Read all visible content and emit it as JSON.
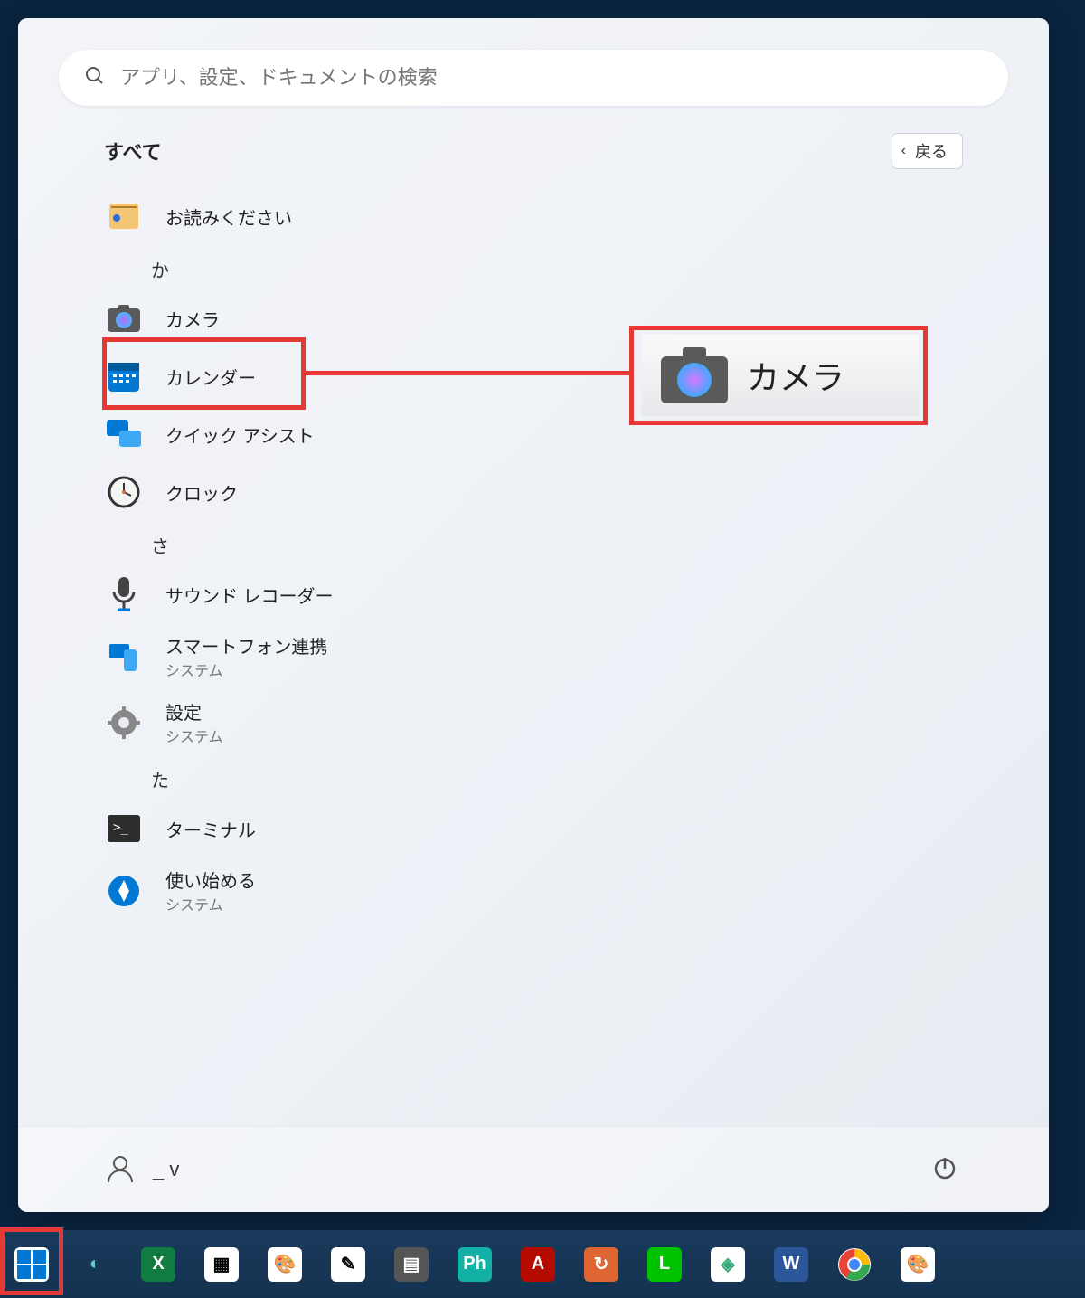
{
  "search": {
    "placeholder": "アプリ、設定、ドキュメントの検索"
  },
  "header": {
    "all_label": "すべて",
    "back_label": "戻る"
  },
  "sections": {
    "readme_label": "お読みください",
    "letter_ka": "か",
    "camera_label": "カメラ",
    "calendar_label": "カレンダー",
    "quickassist_label": "クイック アシスト",
    "clock_label": "クロック",
    "letter_sa": "さ",
    "soundrec_label": "サウンド レコーダー",
    "phonelink_label": "スマートフォン連携",
    "phonelink_sub": "システム",
    "settings_label": "設定",
    "settings_sub": "システム",
    "letter_ta": "た",
    "terminal_label": "ターミナル",
    "getstarted_label": "使い始める",
    "getstarted_sub": "システム"
  },
  "callout": {
    "label": "カメラ"
  },
  "footer": {
    "user_name": "_ v"
  },
  "taskbar": {
    "items": [
      {
        "name": "start",
        "letter": "⊞",
        "bg": "#ffffff",
        "fg": "#0078d4"
      },
      {
        "name": "copilot",
        "letter": "◐",
        "bg": "transparent",
        "fg": "#6cc"
      },
      {
        "name": "excel",
        "letter": "X",
        "bg": "#107c41",
        "fg": "#fff"
      },
      {
        "name": "qr",
        "letter": "▦",
        "bg": "#fff",
        "fg": "#000"
      },
      {
        "name": "paint1",
        "letter": "🎨",
        "bg": "#fff",
        "fg": "#000"
      },
      {
        "name": "paint2",
        "letter": "✎",
        "bg": "#fff",
        "fg": "#000"
      },
      {
        "name": "calculator",
        "letter": "▤",
        "bg": "#555",
        "fg": "#fff"
      },
      {
        "name": "photos",
        "letter": "Ph",
        "bg": "#13b0a5",
        "fg": "#fff"
      },
      {
        "name": "adobe",
        "letter": "A",
        "bg": "#b30b00",
        "fg": "#fff"
      },
      {
        "name": "refresh",
        "letter": "↻",
        "bg": "#d63",
        "fg": "#fff"
      },
      {
        "name": "line",
        "letter": "L",
        "bg": "#00c300",
        "fg": "#fff"
      },
      {
        "name": "diamond",
        "letter": "◈",
        "bg": "#fff",
        "fg": "#3a7"
      },
      {
        "name": "word",
        "letter": "W",
        "bg": "#2b579a",
        "fg": "#fff"
      },
      {
        "name": "chrome",
        "letter": "◉",
        "bg": "#fff",
        "fg": "#333"
      },
      {
        "name": "palette",
        "letter": "🎨",
        "bg": "#fff",
        "fg": "#000"
      }
    ]
  }
}
